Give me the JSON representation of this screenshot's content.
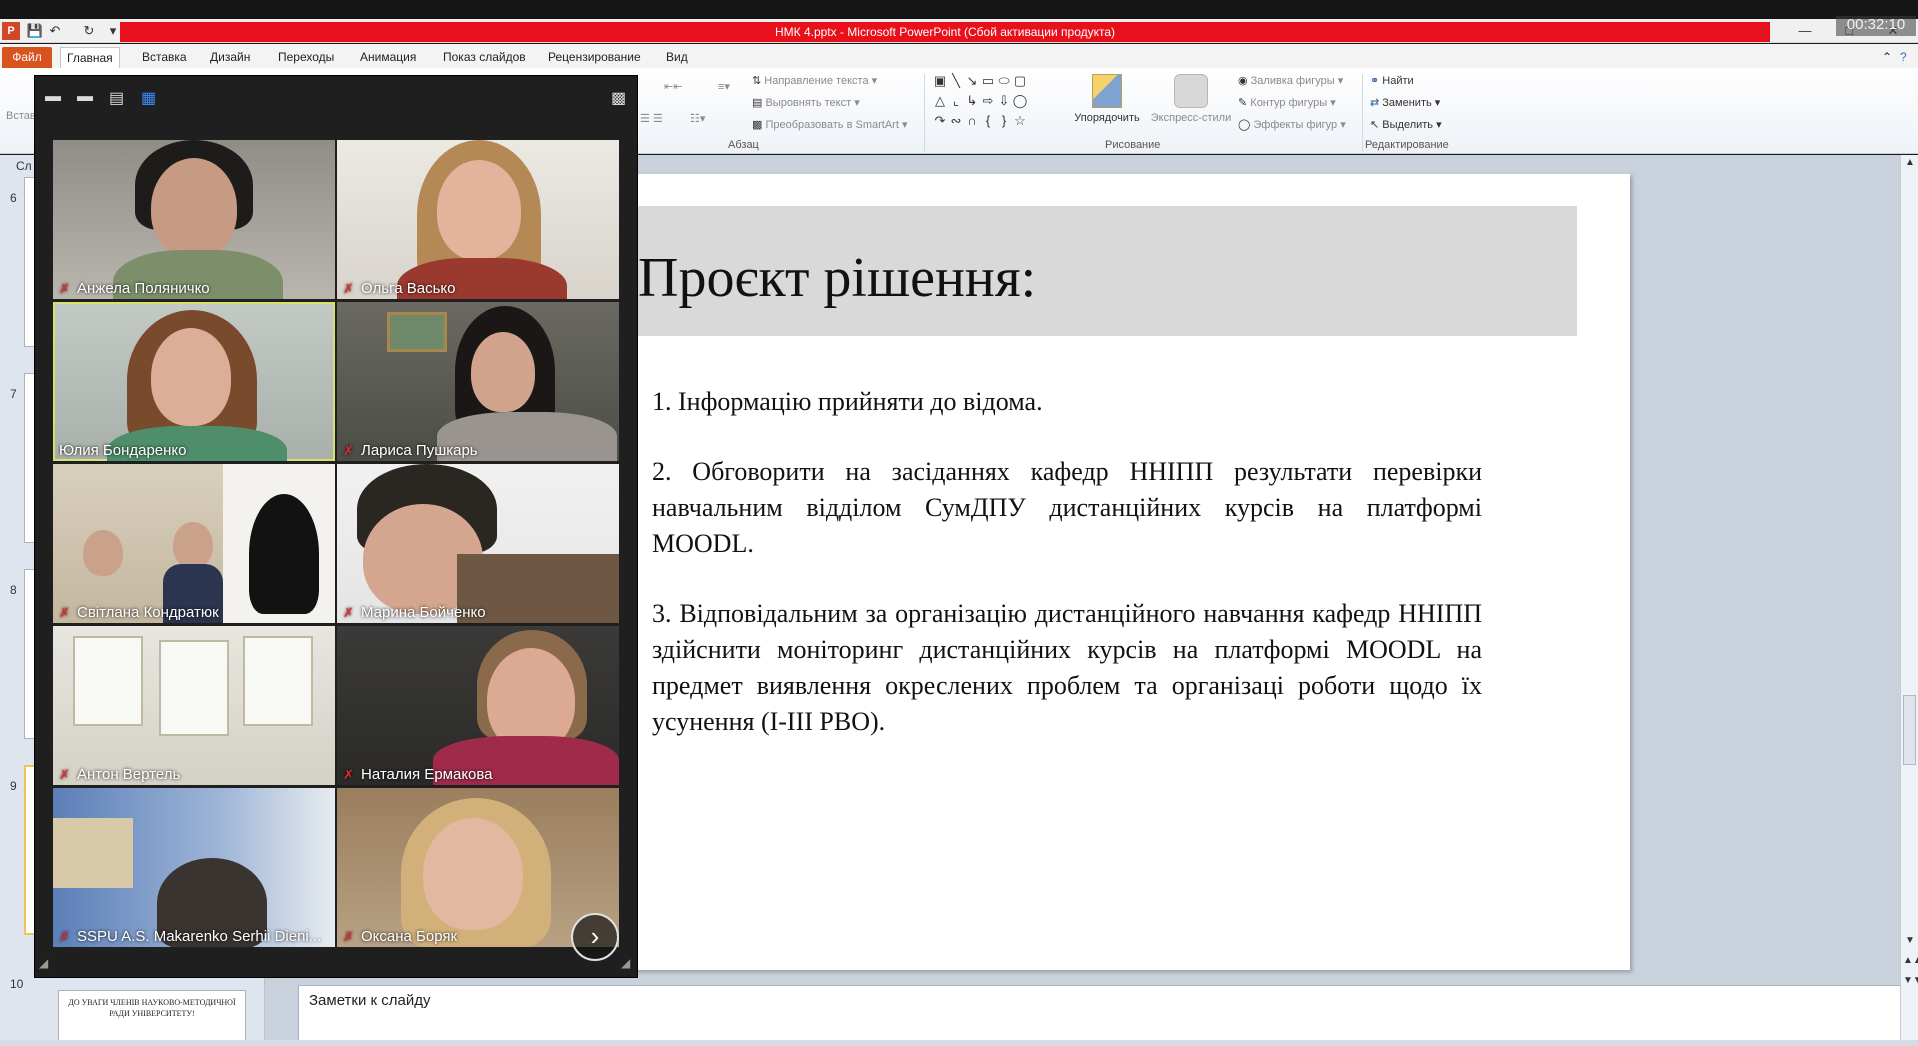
{
  "app": {
    "window_title": "НМК 4.pptx  -  Microsoft PowerPoint (Сбой активации продукта)",
    "recording_timer": "00:32:10"
  },
  "ribbon": {
    "tabs": [
      "Файл",
      "Главная",
      "Вставка",
      "Дизайн",
      "Переходы",
      "Анимация",
      "Показ слайдов",
      "Рецензирование",
      "Вид"
    ],
    "paste_label": "Встав",
    "slides_label": "Сл",
    "paragraph": {
      "text_direction": "Направление текста",
      "align_text": "Выровнять текст",
      "convert_smartart": "Преобразовать в SmartArt",
      "group_label": "Абзац"
    },
    "drawing": {
      "arrange": "Упорядочить",
      "quick_styles": "Экспресс-стили",
      "shape_fill": "Заливка фигуры",
      "shape_outline": "Контур фигуры",
      "shape_effects": "Эффекты фигур",
      "group_label": "Рисование"
    },
    "editing": {
      "find": "Найти",
      "replace": "Заменить",
      "select": "Выделить",
      "group_label": "Редактирование"
    }
  },
  "thumbnails": {
    "numbers": [
      "6",
      "7",
      "8",
      "9",
      "10"
    ],
    "slide10_text": "ДО УВАГИ ЧЛЕНІВ НАУКОВО-МЕТОДИЧНОЇ РАДИ УНІВЕРСИТЕТУ!"
  },
  "slide": {
    "title": "Проєкт рішення:",
    "items": [
      "1. Інформацію прийняти до відома.",
      "2. Обговорити на засіданнях кафедр ННІПП результати перевірки навчальним відділом СумДПУ дистанційних курсів на платформі MOODL.",
      "3. Відповідальним за організацію дистанційного навчання кафедр ННІПП здійснити моніторинг дистанційних курсів на платформі MOODL на предмет виявлення окреслених проблем та організаці роботи щодо їх усунення  (І-ІІІ РВО)."
    ]
  },
  "notes": {
    "placeholder": "Заметки к слайду"
  },
  "video_panel": {
    "participants": [
      {
        "name": "Анжела Поляничко"
      },
      {
        "name": "Ольга Васько"
      },
      {
        "name": "Юлия Бондаренко"
      },
      {
        "name": "Лариса Пушкарь"
      },
      {
        "name": "Світлана Кондратюк"
      },
      {
        "name": "Марина Бойченко"
      },
      {
        "name": "Антон Вертель"
      },
      {
        "name": "Наталия Ермакова"
      },
      {
        "name": "SSPU A.S. Makarenko Serhii Dieni..."
      },
      {
        "name": "Оксана Боряк"
      }
    ],
    "next_page_icon": "chevron-right-icon"
  },
  "colors": {
    "title_bar_red": "#e8101a",
    "file_tab": "#d9531e",
    "active_speaker": "#d6e26c",
    "muted_icon": "#e52b2b"
  }
}
